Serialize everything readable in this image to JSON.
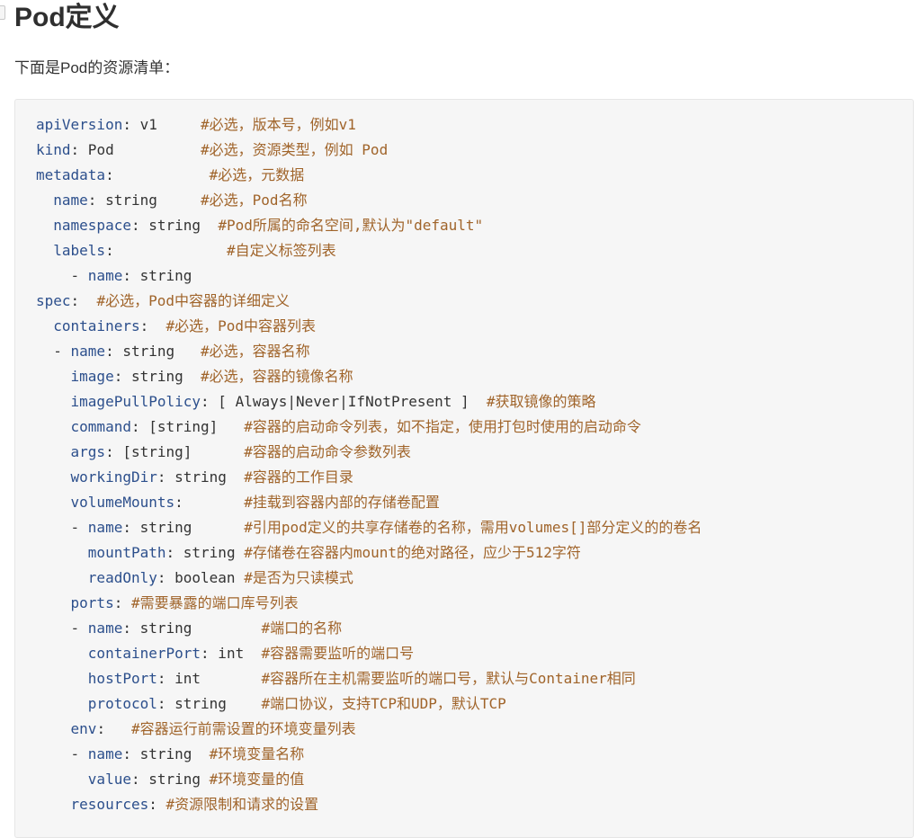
{
  "title": "Pod定义",
  "intro": "下面是Pod的资源清单：",
  "code_lines": [
    {
      "indent": "",
      "key": "apiVersion",
      "value": " v1     ",
      "comment": "#必选，版本号，例如v1"
    },
    {
      "indent": "",
      "key": "kind",
      "value": " Pod          ",
      "comment": "#必选，资源类型，例如 Pod"
    },
    {
      "indent": "",
      "key": "metadata",
      "value": "           ",
      "comment": "#必选，元数据"
    },
    {
      "indent": "  ",
      "key": "name",
      "value": " string     ",
      "comment": "#必选，Pod名称"
    },
    {
      "indent": "  ",
      "key": "namespace",
      "value": " string  ",
      "comment": "#Pod所属的命名空间,默认为\"default\""
    },
    {
      "indent": "  ",
      "key": "labels",
      "value": "             ",
      "comment": "#自定义标签列表"
    },
    {
      "indent": "    - ",
      "key": "name",
      "value": " string",
      "comment": ""
    },
    {
      "indent": "",
      "key": "spec",
      "value": "  ",
      "comment": "#必选，Pod中容器的详细定义"
    },
    {
      "indent": "  ",
      "key": "containers",
      "value": "  ",
      "comment": "#必选，Pod中容器列表"
    },
    {
      "indent": "  - ",
      "key": "name",
      "value": " string   ",
      "comment": "#必选，容器名称"
    },
    {
      "indent": "    ",
      "key": "image",
      "value": " string  ",
      "comment": "#必选，容器的镜像名称"
    },
    {
      "indent": "    ",
      "key": "imagePullPolicy",
      "value": " [ Always|Never|IfNotPresent ]  ",
      "comment": "#获取镜像的策略"
    },
    {
      "indent": "    ",
      "key": "command",
      "value": " [string]   ",
      "comment": "#容器的启动命令列表，如不指定，使用打包时使用的启动命令"
    },
    {
      "indent": "    ",
      "key": "args",
      "value": " [string]      ",
      "comment": "#容器的启动命令参数列表"
    },
    {
      "indent": "    ",
      "key": "workingDir",
      "value": " string  ",
      "comment": "#容器的工作目录"
    },
    {
      "indent": "    ",
      "key": "volumeMounts",
      "value": "       ",
      "comment": "#挂载到容器内部的存储卷配置"
    },
    {
      "indent": "    - ",
      "key": "name",
      "value": " string      ",
      "comment": "#引用pod定义的共享存储卷的名称，需用volumes[]部分定义的的卷名"
    },
    {
      "indent": "      ",
      "key": "mountPath",
      "value": " string ",
      "comment": "#存储卷在容器内mount的绝对路径，应少于512字符"
    },
    {
      "indent": "      ",
      "key": "readOnly",
      "value": " boolean ",
      "comment": "#是否为只读模式"
    },
    {
      "indent": "    ",
      "key": "ports",
      "value": " ",
      "comment": "#需要暴露的端口库号列表"
    },
    {
      "indent": "    - ",
      "key": "name",
      "value": " string        ",
      "comment": "#端口的名称"
    },
    {
      "indent": "      ",
      "key": "containerPort",
      "value": " int  ",
      "comment": "#容器需要监听的端口号"
    },
    {
      "indent": "      ",
      "key": "hostPort",
      "value": " int       ",
      "comment": "#容器所在主机需要监听的端口号，默认与Container相同"
    },
    {
      "indent": "      ",
      "key": "protocol",
      "value": " string    ",
      "comment": "#端口协议，支持TCP和UDP，默认TCP"
    },
    {
      "indent": "    ",
      "key": "env",
      "value": "   ",
      "comment": "#容器运行前需设置的环境变量列表"
    },
    {
      "indent": "    - ",
      "key": "name",
      "value": " string  ",
      "comment": "#环境变量名称"
    },
    {
      "indent": "      ",
      "key": "value",
      "value": " string ",
      "comment": "#环境变量的值"
    },
    {
      "indent": "    ",
      "key": "resources",
      "value": " ",
      "comment": "#资源限制和请求的设置"
    }
  ]
}
